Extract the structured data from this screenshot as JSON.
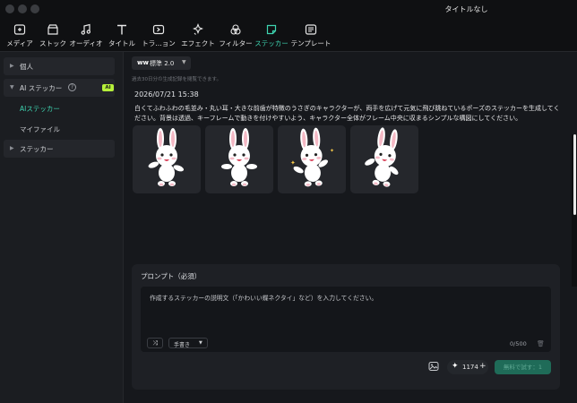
{
  "window": {
    "title": "タイトルなし"
  },
  "toolbar": {
    "tabs": [
      {
        "label": "メディア",
        "icon": "media-icon"
      },
      {
        "label": "ストック",
        "icon": "stock-icon"
      },
      {
        "label": "オーディオ",
        "icon": "audio-icon"
      },
      {
        "label": "タイトル",
        "icon": "title-icon"
      },
      {
        "label": "トラ…ョン",
        "icon": "transition-icon"
      },
      {
        "label": "エフェクト",
        "icon": "effect-icon"
      },
      {
        "label": "フィルター",
        "icon": "filter-icon"
      },
      {
        "label": "ステッカー",
        "icon": "sticker-icon",
        "active": true
      },
      {
        "label": "テンプレート",
        "icon": "template-icon"
      }
    ],
    "accent_color": "#3ed4b0"
  },
  "sidebar": {
    "items": [
      {
        "label": "個人"
      },
      {
        "label": "AI ステッカー",
        "badge": "AI",
        "help": "?"
      },
      {
        "label": "AIステッカー",
        "active": true
      },
      {
        "label": "マイファイル"
      },
      {
        "label": "ステッカー"
      }
    ]
  },
  "main": {
    "model": {
      "label": "標準 2.0",
      "logo": "ww"
    },
    "history_note": "過去30日分の生成記録を閲覧できます。",
    "timestamp": "2026/07/21 15:38",
    "prompt_text": "白くてふわふわの毛並み・丸い耳・大きな前歯が特徴のうさぎのキャラクターが、両手を広げて元気に飛び跳ねているポーズのステッカーを生成してください。背景は透過、キーフレームで動きを付けやすいよう、キャラクター全体がフレーム中央に収まるシンプルな構図にしてください。",
    "thumbnail_count": 4
  },
  "prompt_panel": {
    "title": "プロンプト（必須）",
    "placeholder": "作成するステッカーの説明文（「かわいい蝶ネクタイ」など）を入力してください。",
    "style_label": "手書き",
    "counter": "0/500",
    "credits": "1174",
    "generate_label": "無料で試す：1"
  }
}
